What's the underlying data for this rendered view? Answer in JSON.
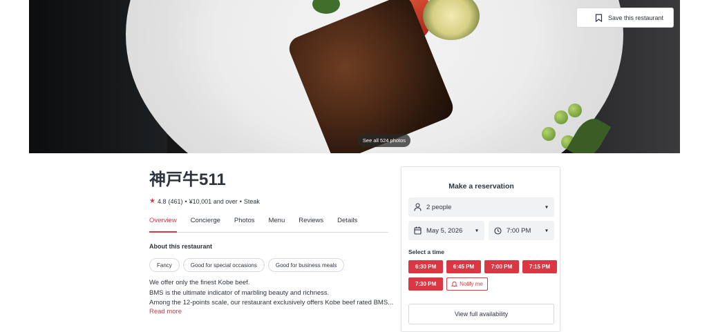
{
  "hero": {
    "save_label": "Save this restaurant",
    "see_photos_label": "See all 524 photos"
  },
  "restaurant": {
    "name": "神戸牛511",
    "rating": "4.8",
    "reviews": "(461)",
    "price": "¥10,001 and over",
    "cuisine": "Steak",
    "separator": "•"
  },
  "tabs": [
    {
      "label": "Overview",
      "active": true
    },
    {
      "label": "Concierge"
    },
    {
      "label": "Photos"
    },
    {
      "label": "Menu"
    },
    {
      "label": "Reviews"
    },
    {
      "label": "Details"
    }
  ],
  "about": {
    "heading": "About this restaurant",
    "tags": [
      "Fancy",
      "Good for special occasions",
      "Good for business meals"
    ],
    "description": [
      "We offer only the finest Kobe beef.",
      "BMS is the ultimate indicator of marbling beauty and richness.",
      "Among the 12-points scale, our restaurant exclusively offers Kobe beef rated BMS..."
    ],
    "read_more": "Read more"
  },
  "reservation": {
    "title": "Make a reservation",
    "party": "2 people",
    "date": "May 5, 2026",
    "time": "7:00 PM",
    "select_time_label": "Select a time",
    "slots": [
      "6:30 PM",
      "6:45 PM",
      "7:00 PM",
      "7:15 PM",
      "7:30 PM"
    ],
    "notify_label": "Notify me",
    "view_full_label": "View full availability"
  },
  "colors": {
    "accent": "#da3743",
    "text": "#2d333f"
  }
}
